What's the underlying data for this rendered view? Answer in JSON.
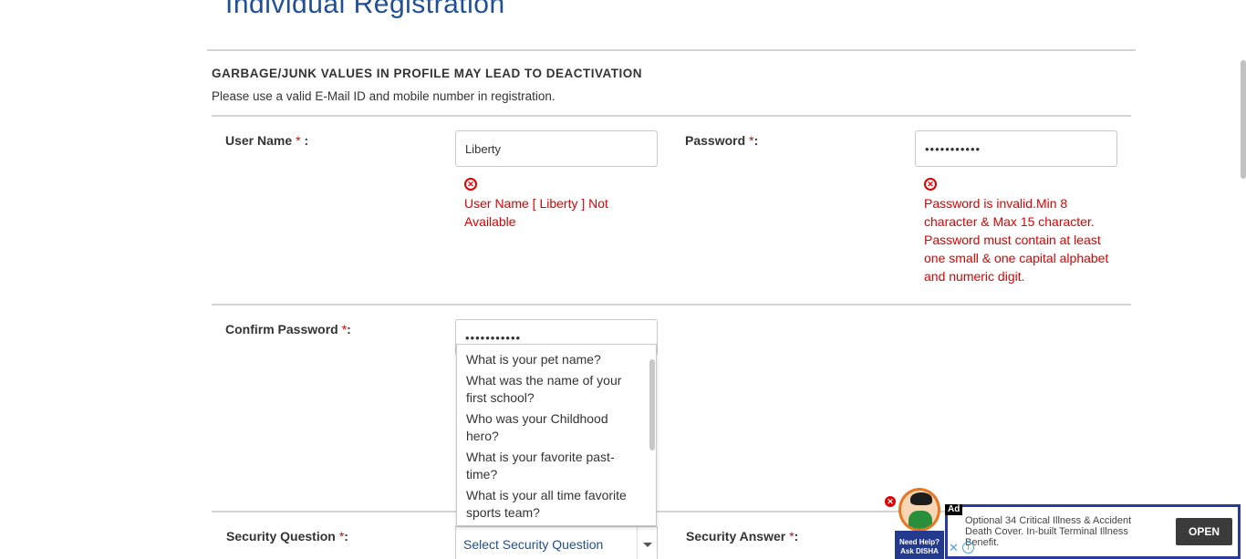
{
  "page": {
    "title": "Individual Registration",
    "warning_title": "GARBAGE/JUNK VALUES IN PROFILE MAY LEAD TO DEACTIVATION",
    "warning_sub": "Please use a valid E-Mail ID and mobile number in registration."
  },
  "form": {
    "required_mark": "*",
    "username": {
      "label": "User Name",
      "colon": " :",
      "value": "Liberty",
      "error": "User Name [ Liberty ] Not Available"
    },
    "password": {
      "label": "Password",
      "colon": ":",
      "value": "•••••••••••",
      "error": "Password is invalid.Min 8 character & Max 15 character. Password must contain at least one small & one capital alphabet and numeric digit."
    },
    "confirm_password": {
      "label": "Confirm Password",
      "colon": ":",
      "value": "•••••••••••"
    },
    "security_question": {
      "label": "Security Question",
      "colon": ":",
      "selected": "Select Security Question",
      "options": [
        "What is your pet name?",
        "What was the name of your first school?",
        "Who was your Childhood hero?",
        "What is your favorite past-time?",
        "What is your all time favorite sports team?"
      ]
    },
    "security_answer": {
      "label": "Security Answer",
      "colon": ":"
    }
  },
  "ad": {
    "tag": "Ad",
    "text": "Optional 34 Critical Illness & Accident Death Cover. In-built Terminal Illness Benefit.",
    "open_label": "OPEN",
    "close_glyph": "✕",
    "info_glyph": "i"
  },
  "disha": {
    "line1": "Need Help?",
    "line2": "Ask DISHA",
    "close_glyph": "✕"
  },
  "icons": {
    "error_glyph": "✕"
  },
  "colors": {
    "title": "#1f4f96",
    "error": "#e00000",
    "ad_border": "#2a3a9c"
  }
}
